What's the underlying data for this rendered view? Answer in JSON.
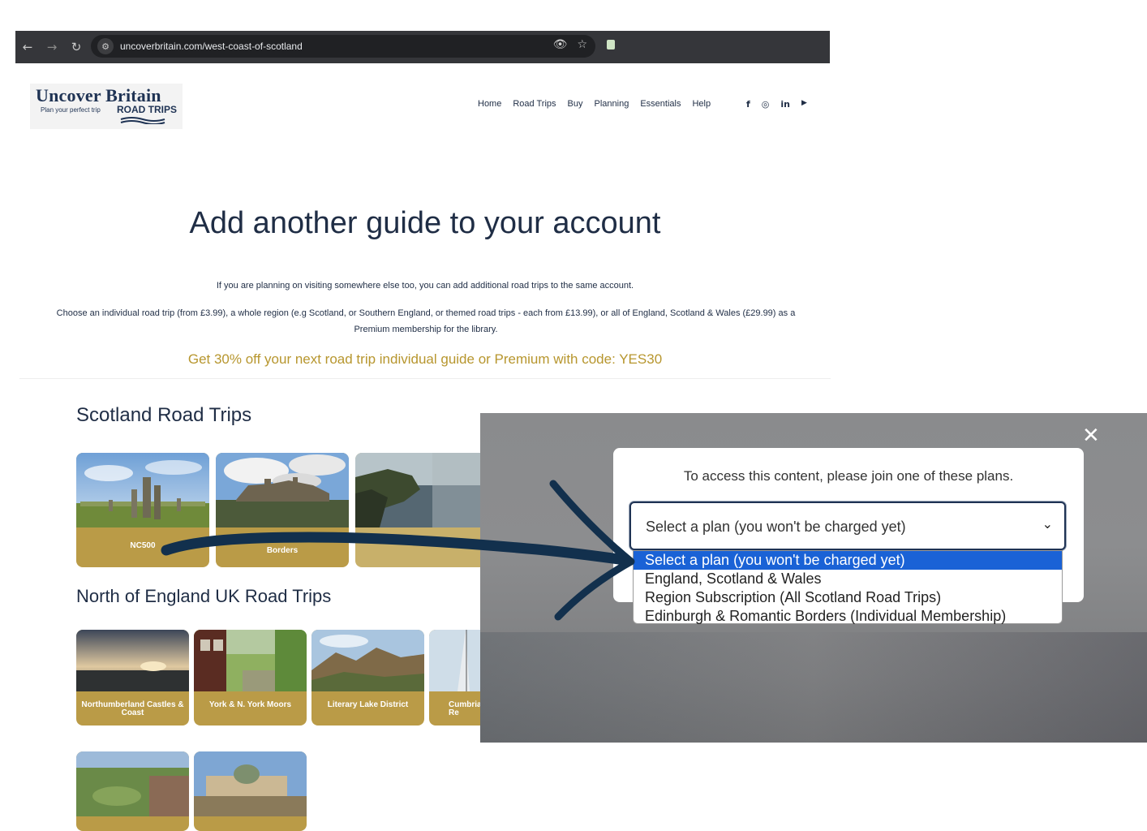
{
  "browser": {
    "url": "uncoverbritain.com/west-coast-of-scotland",
    "back_icon": "←",
    "forward_icon": "→",
    "reload_icon": "↻",
    "site_info_icon": "⚙",
    "eye_icon": "👁",
    "star_icon": "☆"
  },
  "logo": {
    "title": "Uncover Britain",
    "tagline": "Plan your perfect trip",
    "road_trips": "ROAD TRIPS"
  },
  "nav": {
    "items": [
      "Home",
      "Road Trips",
      "Buy",
      "Planning",
      "Essentials",
      "Help"
    ]
  },
  "social": {
    "facebook": "f",
    "instagram": "◎",
    "linkedin": "in",
    "youtube": "▶"
  },
  "main": {
    "headline": "Add another guide to your account",
    "para1": "If you are planning on visiting somewhere else too, you can add additional road trips to the same account.",
    "para2": "Choose an individual road trip (from £3.99), a whole region (e.g Scotland, or Southern England, or themed road trips - each from £13.99), or all of England, Scotland & Wales (£29.99) as a Premium membership for the library.",
    "promo": "Get 30% off your next road trip individual guide or Premium with code: YES30"
  },
  "sections": {
    "scotland": {
      "title": "Scotland Road Trips",
      "cards": [
        "NC500",
        "Borders",
        ""
      ]
    },
    "north_england": {
      "title": "North of England UK Road Trips",
      "cards": [
        "Northumberland Castles & Coast",
        "York & N. York Moors",
        "Literary Lake District",
        "Cumbria Re"
      ]
    }
  },
  "modal": {
    "close": "✕",
    "message": "To access this content, please join one of these plans.",
    "select_value": "Select a plan (you won't be charged yet)",
    "chevron": "⌄",
    "options": [
      "Select a plan (you won't be charged yet)",
      "England, Scotland & Wales",
      "Region Subscription (All Scotland Road Trips)",
      "Edinburgh & Romantic Borders (Individual Membership)"
    ]
  },
  "colors": {
    "brand_navy": "#1f3354",
    "gold": "#b7962e",
    "card_gold": "#ba9b47",
    "option_highlight": "#1a62d6"
  }
}
